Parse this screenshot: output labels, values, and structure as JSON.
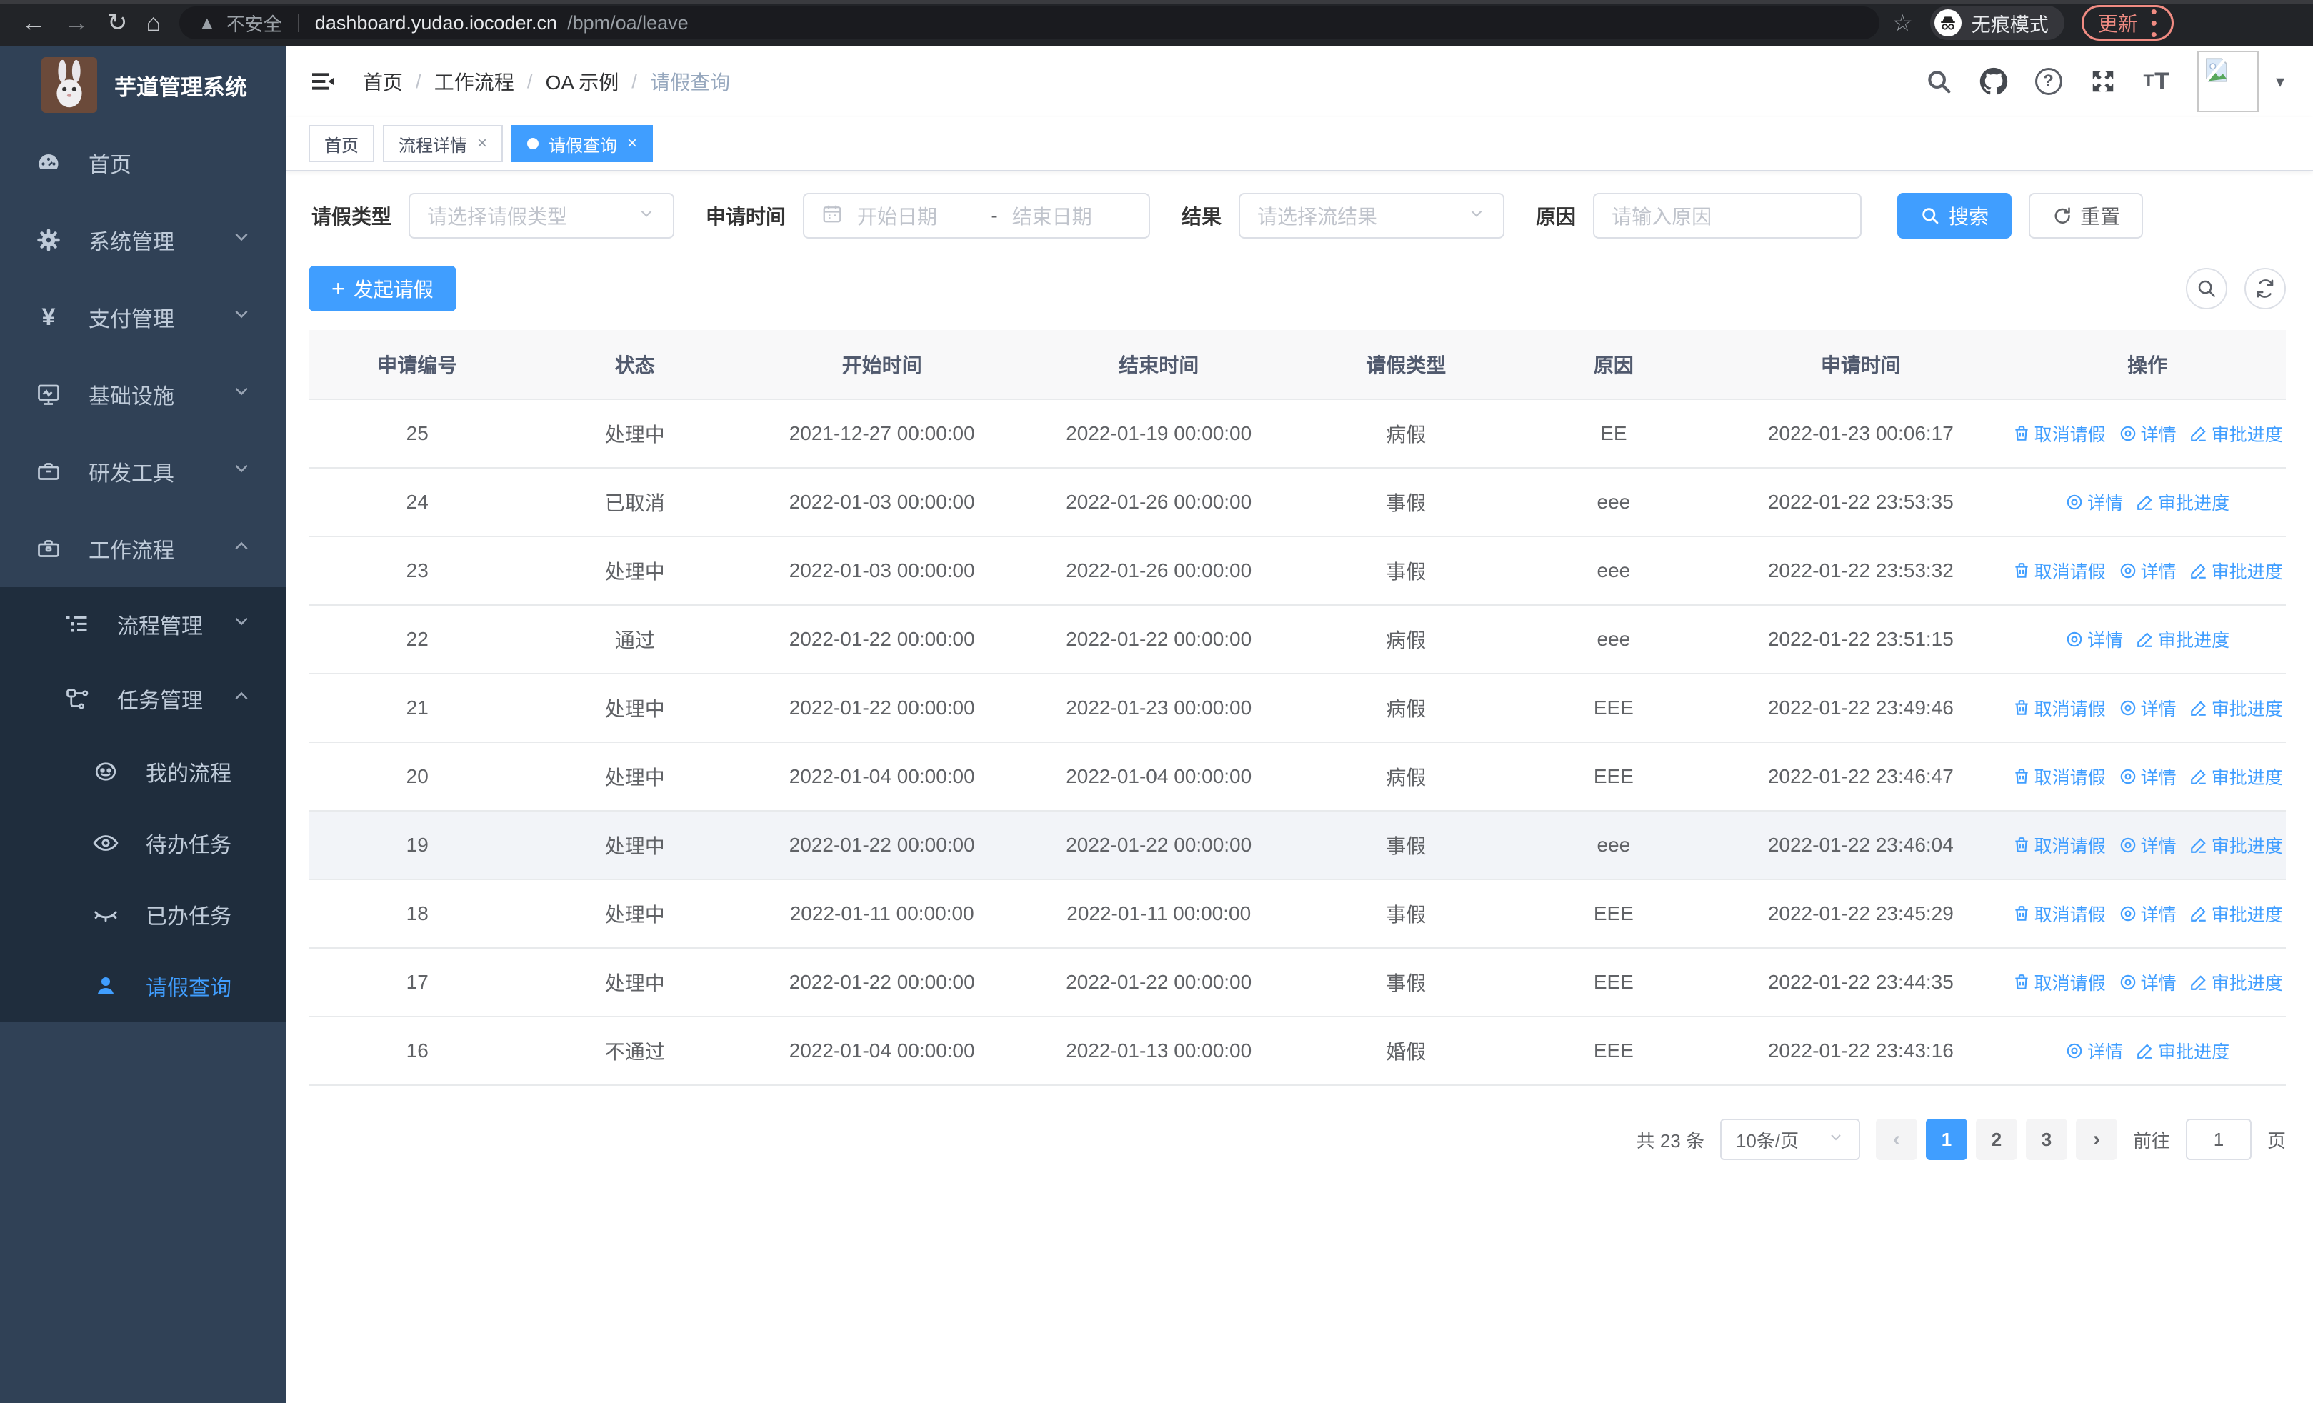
{
  "browser": {
    "security_label": "不安全",
    "url_host": "dashboard.yudao.iocoder.cn",
    "url_path": "/bpm/oa/leave",
    "incognito_label": "无痕模式",
    "update_label": "更新"
  },
  "sidebar": {
    "title": "芋道管理系统",
    "items": [
      {
        "label": "首页",
        "icon": "dashboard-icon",
        "depth": 0,
        "chevron": null,
        "active": false
      },
      {
        "label": "系统管理",
        "icon": "gear-icon",
        "depth": 0,
        "chevron": "down",
        "active": false
      },
      {
        "label": "支付管理",
        "icon": "yen-icon",
        "depth": 0,
        "chevron": "down",
        "active": false
      },
      {
        "label": "基础设施",
        "icon": "monitor-icon",
        "depth": 0,
        "chevron": "down",
        "active": false
      },
      {
        "label": "研发工具",
        "icon": "toolbox-icon",
        "depth": 0,
        "chevron": "down",
        "active": false
      },
      {
        "label": "工作流程",
        "icon": "briefcase-icon",
        "depth": 0,
        "chevron": "up",
        "active": false
      }
    ],
    "submenu_items": [
      {
        "label": "流程管理",
        "icon": "tree-list-icon",
        "depth": 1,
        "chevron": "down",
        "active": false
      },
      {
        "label": "任务管理",
        "icon": "flow-node-icon",
        "depth": 1,
        "chevron": "up",
        "active": false
      },
      {
        "label": "我的流程",
        "icon": "robot-icon",
        "depth": 2,
        "chevron": null,
        "active": false
      },
      {
        "label": "待办任务",
        "icon": "eye-icon",
        "depth": 2,
        "chevron": null,
        "active": false
      },
      {
        "label": "已办任务",
        "icon": "eye-closed-icon",
        "depth": 2,
        "chevron": null,
        "active": false
      },
      {
        "label": "请假查询",
        "icon": "user-icon",
        "depth": 2,
        "chevron": null,
        "active": true
      }
    ]
  },
  "header": {
    "breadcrumb": [
      "首页",
      "工作流程",
      "OA 示例",
      "请假查询"
    ],
    "font_icon_text": "tT"
  },
  "tabs": [
    {
      "label": "首页",
      "closable": false,
      "active": false
    },
    {
      "label": "流程详情",
      "closable": true,
      "active": false
    },
    {
      "label": "请假查询",
      "closable": true,
      "active": true
    }
  ],
  "filters": {
    "leave_type": {
      "label": "请假类型",
      "placeholder": "请选择请假类型"
    },
    "apply_time": {
      "label": "申请时间",
      "start_placeholder": "开始日期",
      "dash": "-",
      "end_placeholder": "结束日期"
    },
    "result": {
      "label": "结果",
      "placeholder": "请选择流结果"
    },
    "reason": {
      "label": "原因",
      "placeholder": "请输入原因"
    },
    "search_label": "搜索",
    "reset_label": "重置"
  },
  "toolbar": {
    "create_label": "发起请假"
  },
  "table": {
    "columns": [
      {
        "key": "id",
        "label": "申请编号"
      },
      {
        "key": "status",
        "label": "状态"
      },
      {
        "key": "start",
        "label": "开始时间"
      },
      {
        "key": "end",
        "label": "结束时间"
      },
      {
        "key": "type",
        "label": "请假类型"
      },
      {
        "key": "reason",
        "label": "原因"
      },
      {
        "key": "apply",
        "label": "申请时间"
      },
      {
        "key": "ops",
        "label": "操作"
      }
    ],
    "action_labels": {
      "cancel": "取消请假",
      "detail": "详情",
      "progress": "审批进度"
    },
    "rows": [
      {
        "id": "25",
        "status": "处理中",
        "start": "2021-12-27 00:00:00",
        "end": "2022-01-19 00:00:00",
        "type": "病假",
        "reason": "EE",
        "apply": "2022-01-23 00:06:17",
        "actions": [
          "cancel",
          "detail",
          "progress"
        ],
        "highlighted": false
      },
      {
        "id": "24",
        "status": "已取消",
        "start": "2022-01-03 00:00:00",
        "end": "2022-01-26 00:00:00",
        "type": "事假",
        "reason": "eee",
        "apply": "2022-01-22 23:53:35",
        "actions": [
          "detail",
          "progress"
        ],
        "highlighted": false
      },
      {
        "id": "23",
        "status": "处理中",
        "start": "2022-01-03 00:00:00",
        "end": "2022-01-26 00:00:00",
        "type": "事假",
        "reason": "eee",
        "apply": "2022-01-22 23:53:32",
        "actions": [
          "cancel",
          "detail",
          "progress"
        ],
        "highlighted": false
      },
      {
        "id": "22",
        "status": "通过",
        "start": "2022-01-22 00:00:00",
        "end": "2022-01-22 00:00:00",
        "type": "病假",
        "reason": "eee",
        "apply": "2022-01-22 23:51:15",
        "actions": [
          "detail",
          "progress"
        ],
        "highlighted": false
      },
      {
        "id": "21",
        "status": "处理中",
        "start": "2022-01-22 00:00:00",
        "end": "2022-01-23 00:00:00",
        "type": "病假",
        "reason": "EEE",
        "apply": "2022-01-22 23:49:46",
        "actions": [
          "cancel",
          "detail",
          "progress"
        ],
        "highlighted": false
      },
      {
        "id": "20",
        "status": "处理中",
        "start": "2022-01-04 00:00:00",
        "end": "2022-01-04 00:00:00",
        "type": "病假",
        "reason": "EEE",
        "apply": "2022-01-22 23:46:47",
        "actions": [
          "cancel",
          "detail",
          "progress"
        ],
        "highlighted": false
      },
      {
        "id": "19",
        "status": "处理中",
        "start": "2022-01-22 00:00:00",
        "end": "2022-01-22 00:00:00",
        "type": "事假",
        "reason": "eee",
        "apply": "2022-01-22 23:46:04",
        "actions": [
          "cancel",
          "detail",
          "progress"
        ],
        "highlighted": true
      },
      {
        "id": "18",
        "status": "处理中",
        "start": "2022-01-11 00:00:00",
        "end": "2022-01-11 00:00:00",
        "type": "事假",
        "reason": "EEE",
        "apply": "2022-01-22 23:45:29",
        "actions": [
          "cancel",
          "detail",
          "progress"
        ],
        "highlighted": false
      },
      {
        "id": "17",
        "status": "处理中",
        "start": "2022-01-22 00:00:00",
        "end": "2022-01-22 00:00:00",
        "type": "事假",
        "reason": "EEE",
        "apply": "2022-01-22 23:44:35",
        "actions": [
          "cancel",
          "detail",
          "progress"
        ],
        "highlighted": false
      },
      {
        "id": "16",
        "status": "不通过",
        "start": "2022-01-04 00:00:00",
        "end": "2022-01-13 00:00:00",
        "type": "婚假",
        "reason": "EEE",
        "apply": "2022-01-22 23:43:16",
        "actions": [
          "detail",
          "progress"
        ],
        "highlighted": false
      }
    ]
  },
  "pagination": {
    "total_label": "共 23 条",
    "page_size": "10条/页",
    "pages": [
      "1",
      "2",
      "3"
    ],
    "current_page": "1",
    "goto_label": "前往",
    "goto_value": "1",
    "page_suffix": "页"
  },
  "colors": {
    "primary": "#409eff",
    "sidebar_bg": "#304156",
    "submenu_bg": "#1f2d3d",
    "update_accent": "#f08b82"
  }
}
